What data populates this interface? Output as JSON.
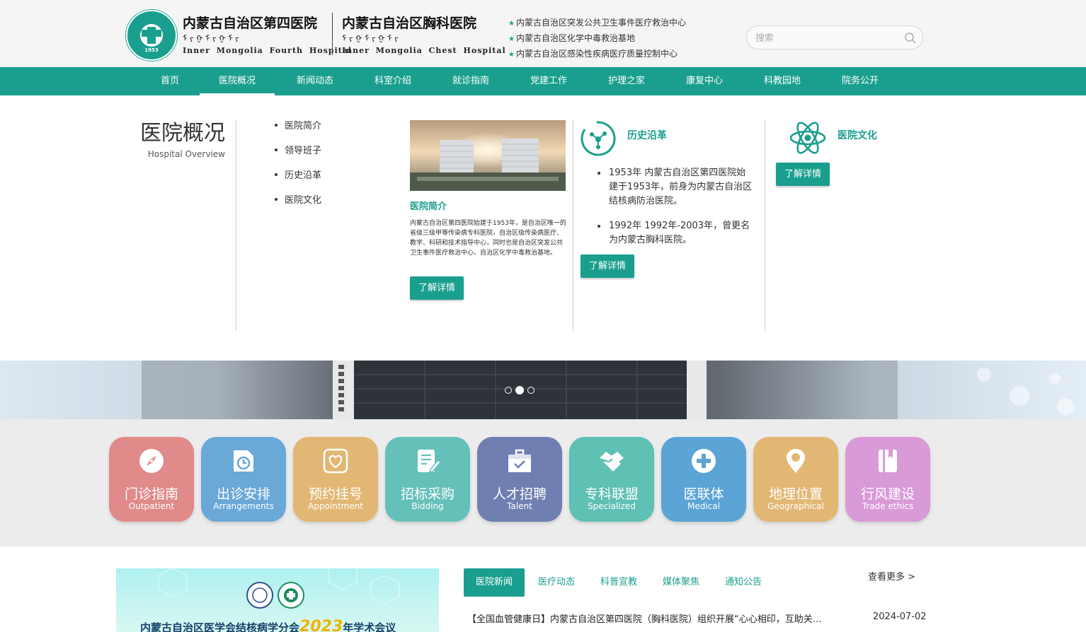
{
  "header": {
    "emblem_year": "1953",
    "hospital1": {
      "name_cn": "内蒙古自治区第四医院",
      "name_mn": "ᠮ ᠶ ᠭ ᠮ ᠶ ᠭ ᠮ ᠶ",
      "name_en": "Inner Mongolia Fourth Hospital"
    },
    "hospital2": {
      "name_cn": "内蒙古自治区胸科医院",
      "name_mn": "ᠮ ᠶ ᠭ ᠮ ᠶ ᠭ ᠮ ᠶ",
      "name_en": "Inner Mongolia Chest Hospital"
    },
    "taglines": [
      "内蒙古自治区突发公共卫生事件医疗救治中心",
      "内蒙古自治区化学中毒救治基地",
      "内蒙古自治区感染性疾病医疗质量控制中心"
    ],
    "search_placeholder": "搜索",
    "search_value": ""
  },
  "nav": {
    "items": [
      "首页",
      "医院概况",
      "新闻动态",
      "科室介绍",
      "就诊指南",
      "党建工作",
      "护理之家",
      "康复中心",
      "科教园地",
      "院务公开"
    ],
    "active": "医院概况"
  },
  "mega": {
    "title": "医院概况",
    "subtitle": "Hospital Overview",
    "submenu": [
      "医院简介",
      "领导班子",
      "历史沿革",
      "医院文化"
    ],
    "intro": {
      "heading": "医院简介",
      "body": "内蒙古自治区第四医院始建于1953年，是自治区唯一的省级三级甲等传染病专科医院，自治区级传染病医疗、教学、科研和技术指导中心，同时也是自治区突发公共卫生事件医疗救治中心、自治区化学中毒救治基地。",
      "button": "了解详情"
    },
    "history": {
      "heading": "历史沿革",
      "items": [
        "1953年 内蒙古自治区第四医院始建于1953年，前身为内蒙古自治区结核病防治医院。",
        "1992年 1992年-2003年，曾更名为内蒙古胸科医院。"
      ],
      "button": "了解详情"
    },
    "culture": {
      "heading": "医院文化",
      "button": "了解详情"
    }
  },
  "banner": {
    "slide_count": 3,
    "active_slide": 2
  },
  "tiles": [
    {
      "cn": "门诊指南",
      "en": "Outpatient",
      "color": "#e08a8a",
      "icon": "compass-icon"
    },
    {
      "cn": "出诊安排",
      "en": "Arrangements",
      "color": "#6aa8d8",
      "icon": "clock-icon"
    },
    {
      "cn": "预约挂号",
      "en": "Appointment",
      "color": "#e2b774",
      "icon": "heart-icon"
    },
    {
      "cn": "招标采购",
      "en": "Bidding",
      "color": "#66c0ba",
      "icon": "document-edit-icon"
    },
    {
      "cn": "人才招聘",
      "en": "Talent",
      "color": "#6f7fb2",
      "icon": "briefcase-icon"
    },
    {
      "cn": "专科联盟",
      "en": "Specialized",
      "color": "#5fc0b4",
      "icon": "handshake-icon"
    },
    {
      "cn": "医联体",
      "en": "Medical",
      "color": "#5aa4d6",
      "icon": "medical-cross-icon"
    },
    {
      "cn": "地理位置",
      "en": "Geographical",
      "color": "#e2b774",
      "icon": "location-pin-icon"
    },
    {
      "cn": "行风建设",
      "en": "Trade ethics",
      "color": "#d99ad8",
      "icon": "book-icon"
    }
  ],
  "news": {
    "image_title": "内蒙古自治区医学会结核病学分会",
    "image_year": "2023",
    "image_suffix": "年学术会议",
    "tabs": [
      "医院新闻",
      "医疗动态",
      "科普宣教",
      "媒体聚焦",
      "通知公告"
    ],
    "active_tab": "医院新闻",
    "more": "查看更多 >",
    "rows": [
      {
        "title": "【全国血管健康日】内蒙古自治区第四医院（胸科医院）组织开展“心心相印，互助关爱”义诊活动",
        "date": "2024-07-02"
      }
    ]
  },
  "colors": {
    "accent": "#1a9f8e"
  }
}
